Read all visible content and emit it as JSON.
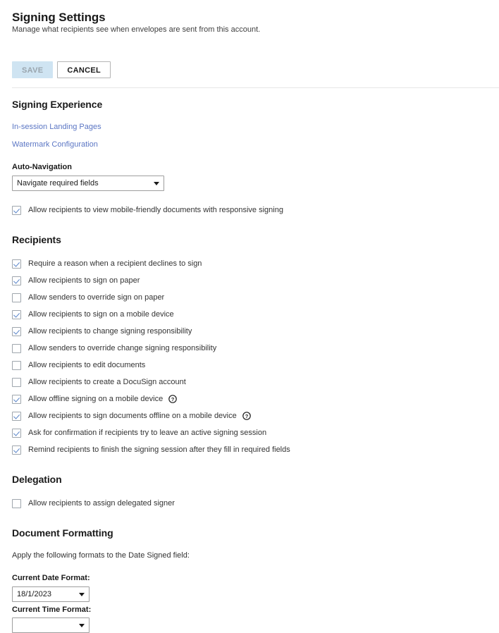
{
  "header": {
    "title": "Signing Settings",
    "subtitle": "Manage what recipients see when envelopes are sent from this account."
  },
  "actions": {
    "save_label": "SAVE",
    "cancel_label": "CANCEL"
  },
  "signing_experience": {
    "heading": "Signing Experience",
    "links": [
      {
        "label": "In-session Landing Pages"
      },
      {
        "label": "Watermark Configuration"
      }
    ],
    "auto_navigation": {
      "label": "Auto-Navigation",
      "value": "Navigate required fields"
    },
    "responsive_signing": {
      "label": "Allow recipients to view mobile-friendly documents with responsive signing",
      "checked": true
    }
  },
  "recipients": {
    "heading": "Recipients",
    "options": [
      {
        "label": "Require a reason when a recipient declines to sign",
        "checked": true,
        "help": false
      },
      {
        "label": "Allow recipients to sign on paper",
        "checked": true,
        "help": false
      },
      {
        "label": "Allow senders to override sign on paper",
        "checked": false,
        "help": false
      },
      {
        "label": "Allow recipients to sign on a mobile device",
        "checked": true,
        "help": false
      },
      {
        "label": "Allow recipients to change signing responsibility",
        "checked": true,
        "help": false
      },
      {
        "label": "Allow senders to override change signing responsibility",
        "checked": false,
        "help": false
      },
      {
        "label": "Allow recipients to edit documents",
        "checked": false,
        "help": false
      },
      {
        "label": "Allow recipients to create a DocuSign account",
        "checked": false,
        "help": false
      },
      {
        "label": "Allow offline signing on a mobile device",
        "checked": true,
        "help": true
      },
      {
        "label": "Allow recipients to sign documents offline on a mobile device",
        "checked": true,
        "help": true
      },
      {
        "label": "Ask for confirmation if recipients try to leave an active signing session",
        "checked": true,
        "help": false
      },
      {
        "label": "Remind recipients to finish the signing session after they fill in required fields",
        "checked": true,
        "help": false
      }
    ]
  },
  "delegation": {
    "heading": "Delegation",
    "options": [
      {
        "label": "Allow recipients to assign delegated signer",
        "checked": false,
        "help": false
      }
    ]
  },
  "document_formatting": {
    "heading": "Document Formatting",
    "description": "Apply the following formats to the Date Signed field:",
    "date_format": {
      "label": "Current Date Format:",
      "value": "18/1/2023"
    },
    "time_format": {
      "label": "Current Time Format:",
      "value": ""
    }
  },
  "icons": {
    "help": "question-mark-circle-icon",
    "dropdown": "chevron-down-icon",
    "check": "checkmark-icon"
  },
  "colors": {
    "link": "#5b76c4",
    "check": "#5b86c9",
    "save_bg": "#cfe4f2",
    "text": "#333333"
  }
}
